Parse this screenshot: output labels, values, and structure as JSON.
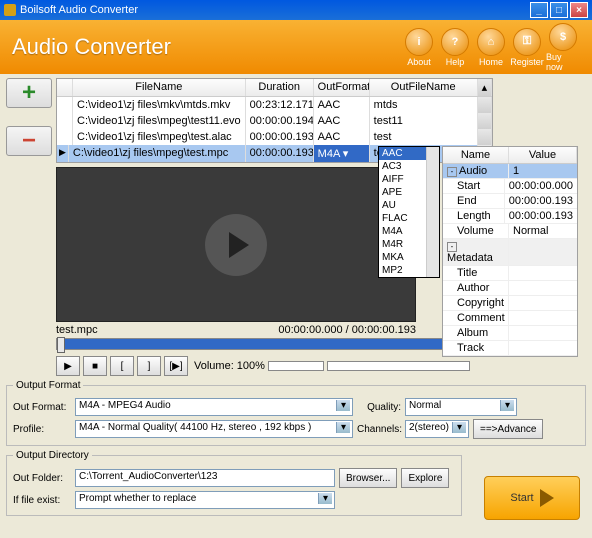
{
  "window": {
    "title": "Boilsoft Audio Converter"
  },
  "header": {
    "title": "Audio Converter",
    "buttons": [
      {
        "label": "About",
        "glyph": "i"
      },
      {
        "label": "Help",
        "glyph": "?"
      },
      {
        "label": "Home",
        "glyph": "⌂"
      },
      {
        "label": "Register",
        "glyph": "⚿"
      },
      {
        "label": "Buy now",
        "glyph": "$"
      }
    ]
  },
  "grid": {
    "cols": {
      "filename": "FileName",
      "duration": "Duration",
      "outformat": "OutFormat",
      "outfilename": "OutFileName"
    },
    "rows": [
      {
        "fn": "C:\\video1\\zj files\\mkv\\mtds.mkv",
        "dur": "00:23:12.171",
        "fmt": "AAC",
        "out": "mtds"
      },
      {
        "fn": "C:\\video1\\zj files\\mpeg\\test11.evo",
        "dur": "00:00:00.194",
        "fmt": "AAC",
        "out": "test11"
      },
      {
        "fn": "C:\\video1\\zj files\\mpeg\\test.alac",
        "dur": "00:00:00.193",
        "fmt": "AAC",
        "out": "test"
      },
      {
        "fn": "C:\\video1\\zj files\\mpeg\\test.mpc",
        "dur": "00:00:00.193",
        "fmt": "M4A",
        "out": "test_1"
      }
    ]
  },
  "formats": [
    "AAC",
    "AC3",
    "AIFF",
    "APE",
    "AU",
    "FLAC",
    "M4A",
    "M4R",
    "MKA",
    "MP2"
  ],
  "props": {
    "cols": {
      "name": "Name",
      "value": "Value"
    },
    "audio": {
      "label": "Audio",
      "val": "1"
    },
    "rows": [
      {
        "n": "Start",
        "v": "00:00:00.000"
      },
      {
        "n": "End",
        "v": "00:00:00.193"
      },
      {
        "n": "Length",
        "v": "00:00:00.193"
      },
      {
        "n": "Volume",
        "v": "Normal"
      }
    ],
    "meta": {
      "label": "Metadata",
      "items": [
        "Title",
        "Author",
        "Copyright",
        "Comment",
        "Album",
        "Track"
      ]
    }
  },
  "preview": {
    "file": "test.mpc",
    "time": "00:00:00.000 / 00:00:00.193"
  },
  "transport": {
    "vol_label": "Volume:",
    "vol_value": "100%"
  },
  "outputFormat": {
    "legend": "Output Format",
    "out_label": "Out Format:",
    "out_value": "M4A - MPEG4 Audio",
    "quality_label": "Quality:",
    "quality_value": "Normal",
    "profile_label": "Profile:",
    "profile_value": "M4A - Normal Quality( 44100 Hz, stereo , 192 kbps )",
    "channels_label": "Channels:",
    "channels_value": "2(stereo)",
    "advance": "==>Advance"
  },
  "outputDir": {
    "legend": "Output Directory",
    "folder_label": "Out Folder:",
    "folder_value": "C:\\Torrent_AudioConverter\\123",
    "browse": "Browser...",
    "explore": "Explore",
    "exist_label": "If file exist:",
    "exist_value": "Prompt whether to replace"
  },
  "start": "Start"
}
